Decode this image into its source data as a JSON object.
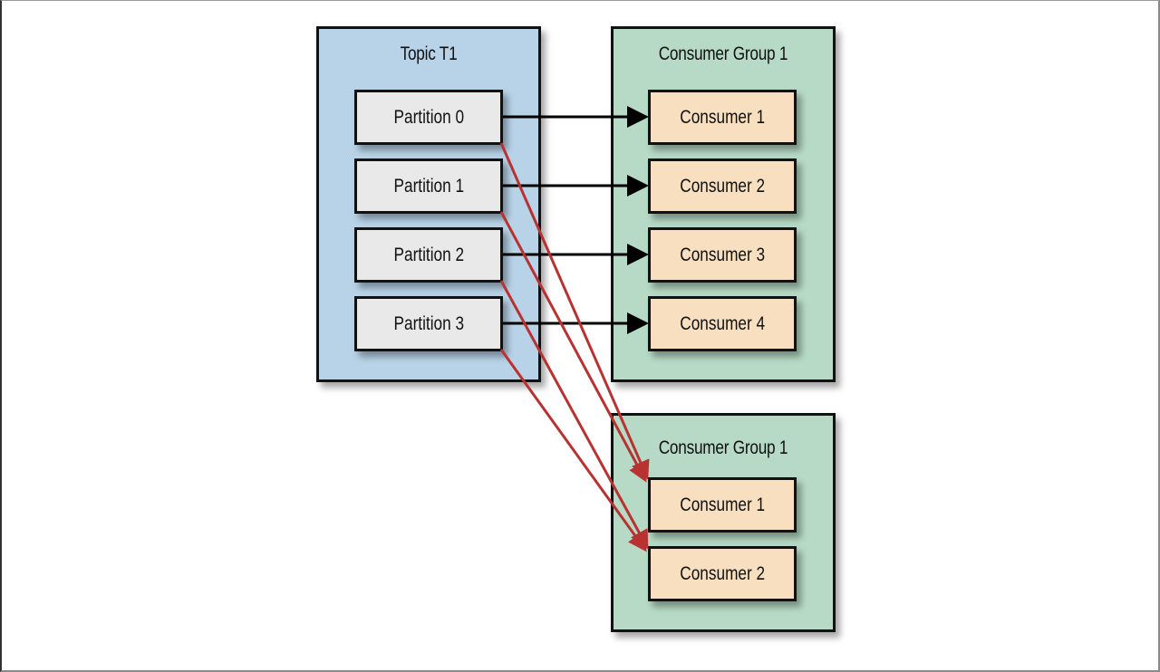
{
  "topic": {
    "title": "Topic T1",
    "partitions": [
      "Partition 0",
      "Partition 1",
      "Partition 2",
      "Partition 3"
    ]
  },
  "groups": [
    {
      "title": "Consumer Group 1",
      "consumers": [
        "Consumer 1",
        "Consumer 2",
        "Consumer 3",
        "Consumer 4"
      ]
    },
    {
      "title": "Consumer Group 1",
      "consumers": [
        "Consumer 1",
        "Consumer 2"
      ]
    }
  ],
  "edges": [
    {
      "from": "Partition 0",
      "to": "Group A / Consumer 1",
      "style": "black"
    },
    {
      "from": "Partition 1",
      "to": "Group A / Consumer 2",
      "style": "black"
    },
    {
      "from": "Partition 2",
      "to": "Group A / Consumer 3",
      "style": "black"
    },
    {
      "from": "Partition 3",
      "to": "Group A / Consumer 4",
      "style": "black"
    },
    {
      "from": "Partition 0",
      "to": "Group B / Consumer 1",
      "style": "red"
    },
    {
      "from": "Partition 1",
      "to": "Group B / Consumer 1",
      "style": "red"
    },
    {
      "from": "Partition 2",
      "to": "Group B / Consumer 2",
      "style": "red"
    },
    {
      "from": "Partition 3",
      "to": "Group B / Consumer 2",
      "style": "red"
    }
  ],
  "colors": {
    "topic_fill": "#b8d3e8",
    "group_fill": "#b6dac5",
    "partition_fill": "#e9e9e9",
    "consumer_fill": "#f8dfbf",
    "black_arrow": "#000000",
    "red_arrow": "#b83232"
  }
}
